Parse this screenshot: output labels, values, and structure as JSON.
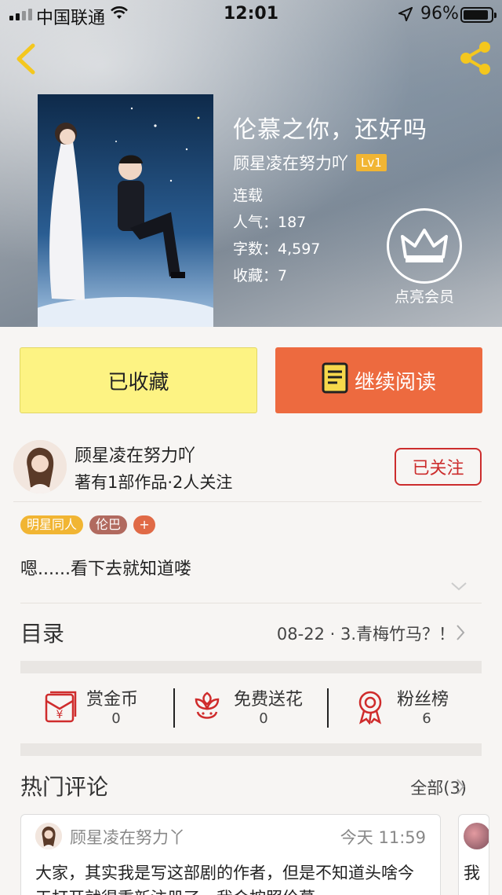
{
  "status_bar": {
    "carrier": "中国联通",
    "time": "12:01",
    "battery": "96%"
  },
  "book": {
    "title": "伦慕之你，还好吗",
    "author": "顾星凌在努力吖",
    "level": "Lv1",
    "status": "连载",
    "popularity": "人气：187",
    "word_count": "字数：4,597",
    "favorites": "收藏：7"
  },
  "vip": {
    "label": "点亮会员"
  },
  "actions": {
    "favorite_label": "已收藏",
    "read_label": "继续阅读"
  },
  "author_info": {
    "name": "顾星凌在努力吖",
    "works": "著有1部作品·2人关注",
    "follow_label": "已关注"
  },
  "tags": [
    "明星同人",
    "伦巴",
    "+"
  ],
  "intro": "嗯......看下去就知道喽",
  "toc": {
    "label": "目录",
    "latest": "08-22 · 3.青梅竹马？！"
  },
  "stats": [
    {
      "label": "赏金币",
      "value": "0",
      "icon": "red-envelope-icon"
    },
    {
      "label": "免费送花",
      "value": "0",
      "icon": "flower-icon"
    },
    {
      "label": "粉丝榜",
      "value": "6",
      "icon": "rosette-icon"
    }
  ],
  "comments": {
    "label": "热门评论",
    "all_label": "全部(3)",
    "items": [
      {
        "user": "顾星凌在努力丫",
        "time": "今天 11:59",
        "text": "大家，其实我是写这部剧的作者，但是不知道头啥今天打开就得重新注册了，我会按照伦慕"
      },
      {
        "text": "我"
      }
    ]
  },
  "colors": {
    "favorite_bg": "#fdf383",
    "read_bg": "#ed6a3f",
    "follow_red": "#cc2d2d",
    "accent_yellow": "#f1b533"
  }
}
